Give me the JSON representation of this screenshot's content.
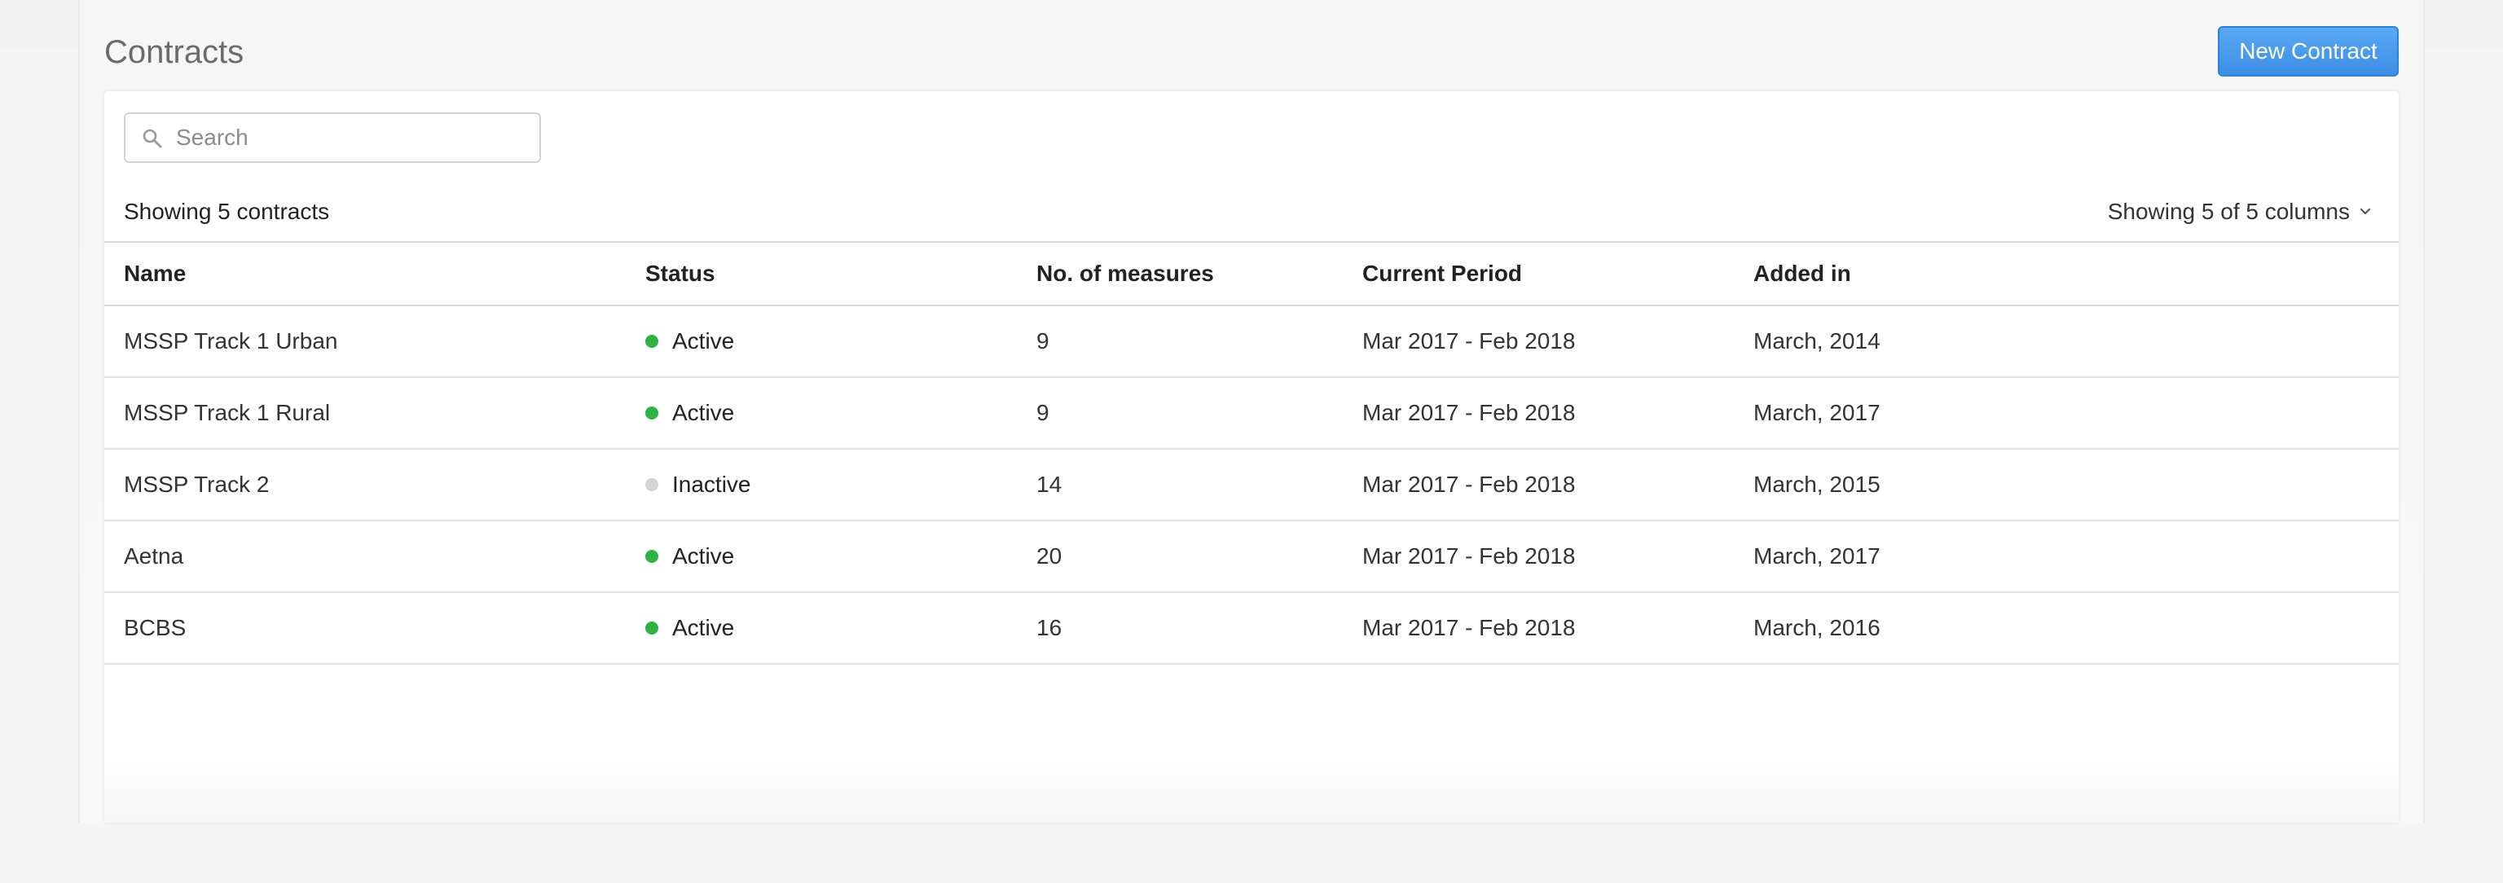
{
  "header": {
    "title": "Contracts",
    "new_button_label": "New Contract"
  },
  "search": {
    "placeholder": "Search",
    "value": ""
  },
  "summary": {
    "count_label": "Showing 5 contracts",
    "columns_label": "Showing 5 of 5 columns"
  },
  "table": {
    "columns": [
      "Name",
      "Status",
      "No. of measures",
      "Current Period",
      "Added in"
    ],
    "rows": [
      {
        "name": "MSSP Track 1 Urban",
        "status": "Active",
        "measures": "9",
        "period": "Mar 2017 - Feb 2018",
        "added": "March, 2014"
      },
      {
        "name": "MSSP Track 1 Rural",
        "status": "Active",
        "measures": "9",
        "period": "Mar 2017 - Feb 2018",
        "added": "March, 2017"
      },
      {
        "name": "MSSP Track 2",
        "status": "Inactive",
        "measures": "14",
        "period": "Mar 2017 - Feb 2018",
        "added": "March, 2015"
      },
      {
        "name": "Aetna",
        "status": "Active",
        "measures": "20",
        "period": "Mar 2017 - Feb 2018",
        "added": "March, 2017"
      },
      {
        "name": "BCBS",
        "status": "Active",
        "measures": "16",
        "period": "Mar 2017 - Feb 2018",
        "added": "March, 2016"
      }
    ]
  },
  "colors": {
    "accent": "#3d8ee6",
    "status_active": "#2fb344",
    "status_inactive": "#d4d4d4"
  },
  "icons": {
    "search": "search-icon",
    "columns_toggle": "chevron-down-icon",
    "status": "status-dot-icon"
  }
}
